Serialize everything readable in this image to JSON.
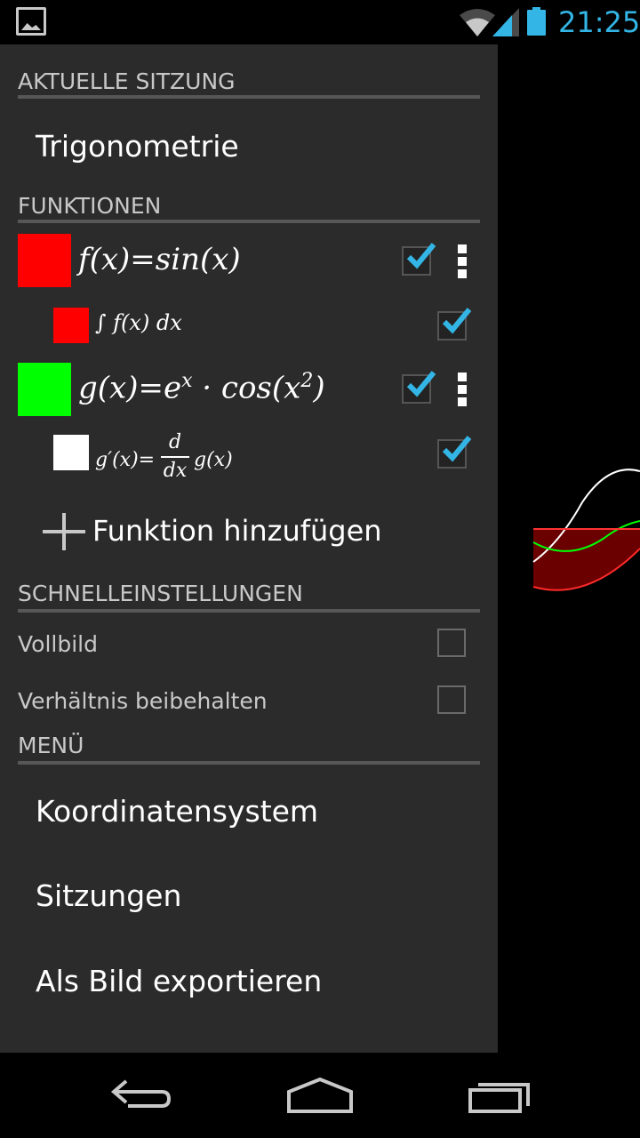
{
  "status_bar": {
    "time": "21:25"
  },
  "session": {
    "header": "AKTUELLE SITZUNG",
    "name": "Trigonometrie"
  },
  "functions": {
    "header": "FUNKTIONEN",
    "items": [
      {
        "color": "#ff0000",
        "f_name": "f(x)=sin(x)",
        "checked": true
      },
      {
        "color": "#ff0000",
        "integral": "∫",
        "integrand": "f(x) dx",
        "checked": true
      },
      {
        "color": "#00ff00",
        "g_lhs": "g(x)=e",
        "g_exp": "x",
        "g_mid": " · cos(x",
        "g_sq": "2",
        "g_end": ")",
        "checked": true
      },
      {
        "color": "#ffffff",
        "d_lhs": "g′(x)=",
        "d_num": "d",
        "d_den": "dx",
        "d_rhs": "g(x)",
        "checked": true
      }
    ],
    "add_label": "Funktion hinzufügen"
  },
  "quick_settings": {
    "header": "SCHNELLEINSTELLUNGEN",
    "fullscreen": "Vollbild",
    "keep_ratio": "Verhältnis beibehalten"
  },
  "menu": {
    "header": "MENÜ",
    "items": [
      "Koordinatensystem",
      "Sitzungen",
      "Als Bild exportieren"
    ]
  },
  "colors": {
    "accent": "#33b5e5",
    "drawer_bg": "#2b2b2b",
    "integral_fill": "#6b0000"
  },
  "icons": [
    "gallery-icon",
    "wifi-icon",
    "signal-icon",
    "battery-icon",
    "plus-icon",
    "checkmark-icon",
    "overflow-menu-icon",
    "back-icon",
    "home-icon",
    "recents-icon"
  ]
}
